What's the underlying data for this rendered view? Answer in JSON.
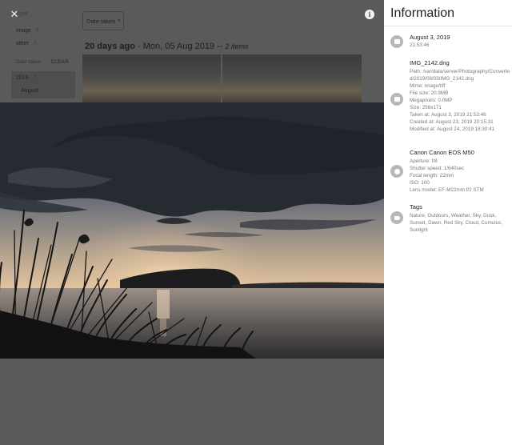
{
  "filters": {
    "type_heading": "Type",
    "types": [
      {
        "label": "image",
        "count": "3"
      },
      {
        "label": "other",
        "count": "2"
      }
    ],
    "date_heading": "Date taken",
    "clear_label": "CLEAR",
    "year": {
      "label": "2019",
      "count": "5"
    },
    "month": {
      "label": "August",
      "count": "3"
    }
  },
  "sort": {
    "label": "Date taken",
    "caret": "▾"
  },
  "group": {
    "relative": "20 days ago",
    "date": " - Mon, 05 Aug 2019 -- ",
    "count": "2 items"
  },
  "lightbox": {
    "close_glyph": "✕",
    "info_glyph": "i"
  },
  "info": {
    "title": "Information",
    "date_section": {
      "date": "August 3, 2019",
      "time": "21:53:46"
    },
    "file_section": {
      "name": "IMG_2142.dng",
      "lines": [
        "Path: /var/data/server/Photography/Converted/2019/08/03/IMG_2142.dng",
        "Mime: image/tiff",
        "File size: 20.9MB",
        "Megapixels: 0.0MP",
        "Size: 256x171",
        "Taken at: August 3, 2019 21:53:46",
        "Created at: August 23, 2019 20:15:31",
        "Modified at: August 24, 2019 18:30:41"
      ]
    },
    "camera_section": {
      "name": "Canon Canon EOS M50",
      "lines": [
        "Aperture: f/8",
        "Shutter speed: 1/640sec",
        "Focal length: 22mm",
        "ISO: 100",
        "Lens model: EF-M22mm f/2 STM"
      ]
    },
    "tags_section": {
      "name": "Tags",
      "text": "Nature, Outdoors, Weather, Sky, Dusk, Sunset, Dawn, Red Sky, Cloud, Cumulus, Sunlight"
    }
  },
  "icons": {
    "close": "close-icon",
    "info": "info-icon",
    "calendar": "calendar-icon",
    "image": "image-file-icon",
    "camera": "camera-icon",
    "tag": "tag-icon"
  },
  "colors": {
    "panel_bg": "#ffffff",
    "overlay_bg": "#5a5a5a",
    "icon_circle": "#b8b8b8"
  }
}
